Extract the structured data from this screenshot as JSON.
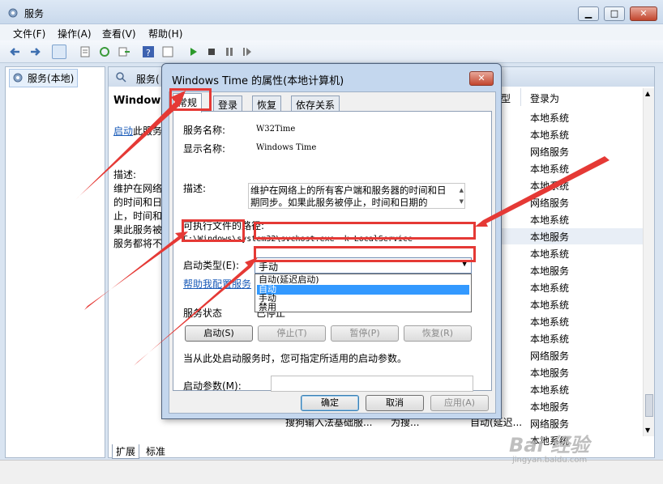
{
  "window": {
    "title": "服务"
  },
  "menu": {
    "file": "文件(F)",
    "action": "操作(A)",
    "view": "查看(V)",
    "help": "帮助(H)"
  },
  "tree": {
    "root": "服务(本地)"
  },
  "services": {
    "header_label": "服务(",
    "selected_title": "Windows",
    "start_link": "启动",
    "start_suffix": "此服务",
    "desc_lines": [
      "描述:",
      "维护在网络",
      "的时间和日",
      "止，时间和",
      "果此服务被",
      "服务都将不"
    ],
    "col_type": "型",
    "col_logon": "登录为",
    "logon_values": [
      "本地系统",
      "本地系统",
      "网络服务",
      "本地系统",
      "本地系统",
      "网络服务",
      "本地系统",
      "本地服务",
      "本地系统",
      "本地服务",
      "本地系统",
      "本地系统",
      "本地系统",
      "本地系统",
      "网络服务",
      "本地服务",
      "本地系统",
      "本地服务",
      "网络服务",
      "本地系统"
    ],
    "bottom_row": {
      "name": "搜狗输入法基础服...",
      "desc": "为搜...",
      "startup": "自动(延迟..."
    },
    "tab_extended": "扩展",
    "tab_standard": "标准"
  },
  "dialog": {
    "title": "Windows Time 的属性(本地计算机)",
    "tabs": [
      "常规",
      "登录",
      "恢复",
      "依存关系"
    ],
    "service_name_label": "服务名称:",
    "service_name": "W32Time",
    "display_name_label": "显示名称:",
    "display_name": "Windows Time",
    "description_label": "描述:",
    "description": "维护在网络上的所有客户端和服务器的时间和日期同步。如果此服务被停止，时间和日期的",
    "path_label": "可执行文件的路径:",
    "path": "C:\\Windows\\system32\\svchost.exe -k LocalService",
    "startup_type_label": "启动类型(E):",
    "startup_type_value": "手动",
    "startup_options": [
      "自动(延迟启动)",
      "自动",
      "手动",
      "禁用"
    ],
    "highlighted_option": "自动",
    "help_link": "帮助我配置服务",
    "status_label": "服务状态",
    "status_value": "已停止",
    "buttons": {
      "start": "启动(S)",
      "stop": "停止(T)",
      "pause": "暂停(P)",
      "resume": "恢复(R)"
    },
    "hint": "当从此处启动服务时，您可指定所适用的启动参数。",
    "param_label": "启动参数(M):",
    "param_value": "",
    "ok": "确定",
    "cancel": "取消",
    "apply": "应用(A)"
  },
  "watermark": {
    "main": "Bai 经验",
    "sub": "jingyan.baidu.com"
  },
  "colors": {
    "annotation": "#e53935",
    "highlight": "#3399ff",
    "link": "#1a5bb8"
  }
}
